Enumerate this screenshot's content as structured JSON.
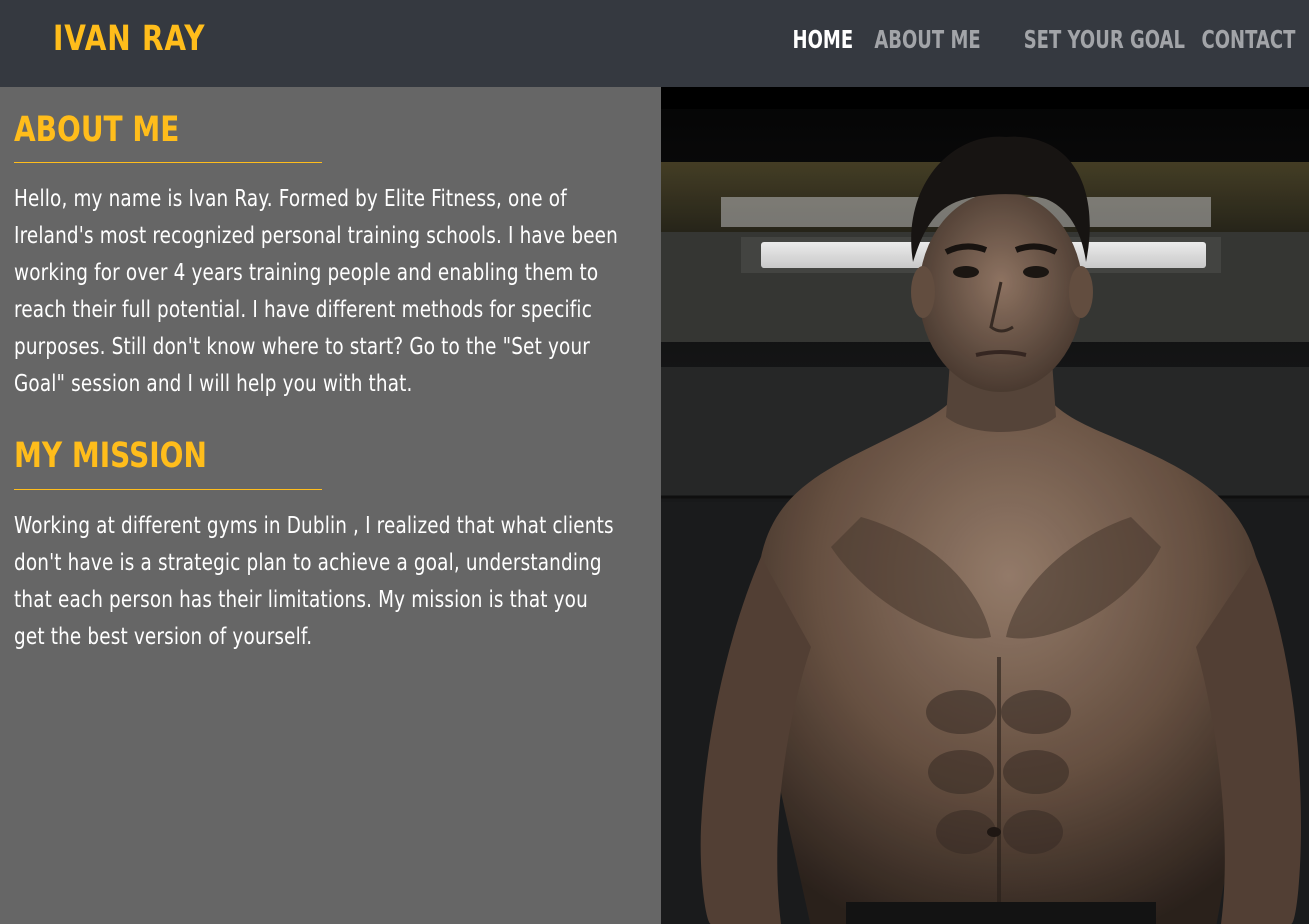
{
  "header": {
    "brand": "IVAN RAY",
    "nav": [
      {
        "label": "HOME",
        "active": true
      },
      {
        "label": "ABOUT ME",
        "active": false
      },
      {
        "label": "SET YOUR GOAL",
        "active": false
      },
      {
        "label": "CONTACT",
        "active": false
      }
    ]
  },
  "about": {
    "heading": "ABOUT ME",
    "text": "Hello, my name is Ivan Ray. Formed by Elite Fitness, one of Ireland's most recognized personal training schools. I have been working for over 4 years training people and enabling them to reach their full potential. I have different methods for specific purposes. Still don't know where to start? Go to the \"Set your Goal\" session and I will help you with that."
  },
  "mission": {
    "heading": "MY MISSION",
    "text": "Working at different gyms in Dublin , I realized that what clients don't have is a strategic plan to achieve a goal, understanding that each person has their limitations. My mission is that you get the best version of yourself."
  },
  "colors": {
    "accent": "#ffbd1b",
    "header_bg": "#353940",
    "panel_bg": "#666666",
    "nav_inactive": "#a2a4a8",
    "nav_active": "#ffffff"
  }
}
